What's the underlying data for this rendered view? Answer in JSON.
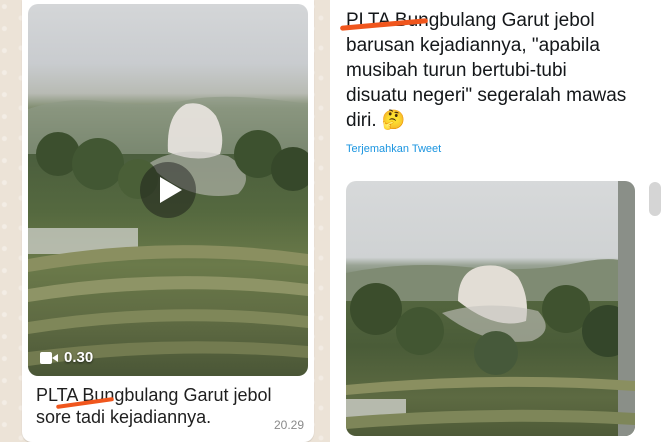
{
  "whatsapp": {
    "duration": "0.30",
    "caption_line1": "PLTA Bungbulang Garut jebol",
    "caption_line2": "sore tadi kejadiannya.",
    "time": "20.29",
    "icons": {
      "play": "play-icon",
      "camera": "video-camera-icon"
    }
  },
  "tweet": {
    "text_lines": [
      "PLTA Bungbulang Garut jebol",
      "barusan kejadiannya, \"apabila",
      "musibah turun bertubi-tubi",
      "disuatu negeri\" segeralah mawas",
      "diri. 🤔"
    ],
    "translate_label": "Terjemahkan Tweet"
  },
  "colors": {
    "highlight": "#f0561d",
    "link": "#1b95e0",
    "chat_bg": "#ece3d7"
  }
}
